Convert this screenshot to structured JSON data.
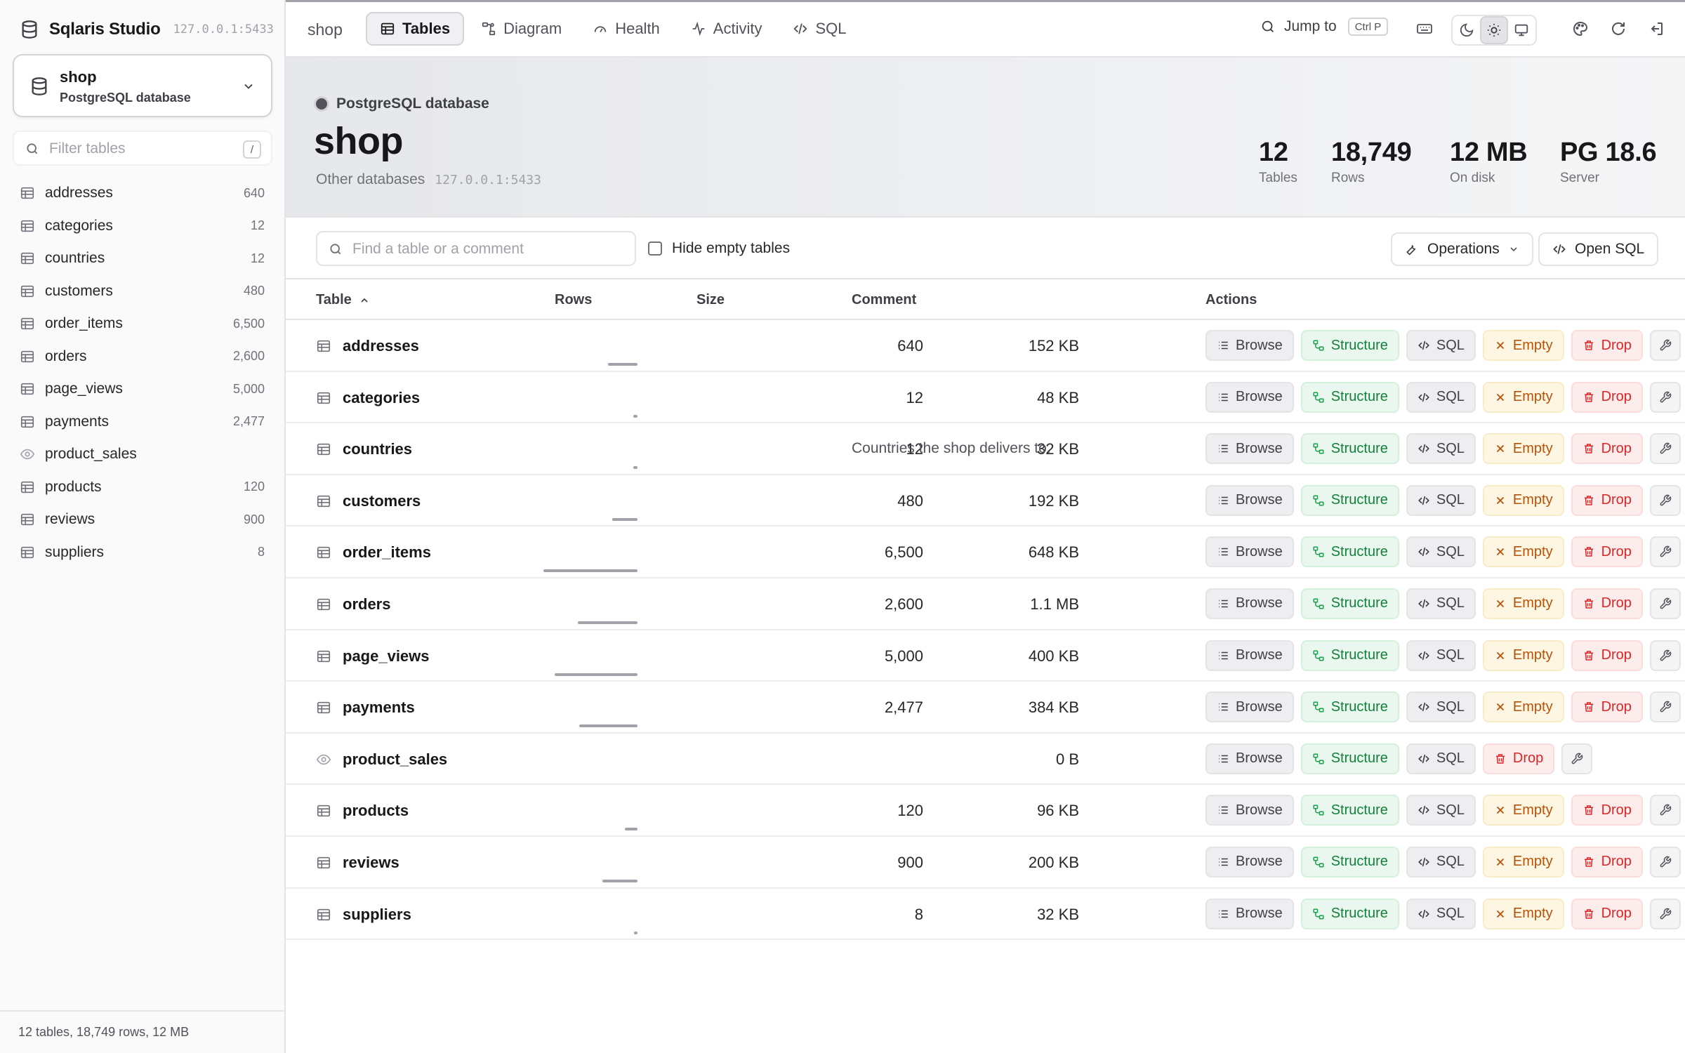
{
  "app": {
    "name": "Sqlaris Studio",
    "host": "127.0.0.1:5433"
  },
  "db_picker": {
    "name": "shop",
    "kind": "PostgreSQL database"
  },
  "sidebar": {
    "filter_placeholder": "Filter tables",
    "filter_shortcut": "/",
    "items": [
      {
        "name": "addresses",
        "count": "640",
        "kind": "table"
      },
      {
        "name": "categories",
        "count": "12",
        "kind": "table"
      },
      {
        "name": "countries",
        "count": "12",
        "kind": "table"
      },
      {
        "name": "customers",
        "count": "480",
        "kind": "table"
      },
      {
        "name": "order_items",
        "count": "6,500",
        "kind": "table"
      },
      {
        "name": "orders",
        "count": "2,600",
        "kind": "table"
      },
      {
        "name": "page_views",
        "count": "5,000",
        "kind": "table"
      },
      {
        "name": "payments",
        "count": "2,477",
        "kind": "table"
      },
      {
        "name": "product_sales",
        "count": "",
        "kind": "view"
      },
      {
        "name": "products",
        "count": "120",
        "kind": "table"
      },
      {
        "name": "reviews",
        "count": "900",
        "kind": "table"
      },
      {
        "name": "suppliers",
        "count": "8",
        "kind": "table"
      }
    ],
    "footer": "12 tables, 18,749 rows, 12 MB"
  },
  "topbar": {
    "breadcrumb": "shop",
    "tabs": [
      {
        "label": "Tables",
        "icon": "table-icon",
        "active": true
      },
      {
        "label": "Diagram",
        "icon": "diagram-icon",
        "active": false
      },
      {
        "label": "Health",
        "icon": "gauge-icon",
        "active": false
      },
      {
        "label": "Activity",
        "icon": "activity-icon",
        "active": false
      },
      {
        "label": "SQL",
        "icon": "code-icon",
        "active": false
      }
    ],
    "jump_label": "Jump to",
    "jump_shortcut": "Ctrl P"
  },
  "header": {
    "kind": "PostgreSQL database",
    "title": "shop",
    "other_link": "Other databases",
    "host": "127.0.0.1:5433",
    "stats": [
      {
        "value": "12",
        "label": "Tables"
      },
      {
        "value": "18,749",
        "label": "Rows"
      },
      {
        "value": "12 MB",
        "label": "On disk"
      },
      {
        "value": "PG 18.6",
        "label": "Server"
      }
    ]
  },
  "toolbar": {
    "find_placeholder": "Find a table or a comment",
    "hide_empty_label": "Hide empty tables",
    "operations_label": "Operations",
    "open_sql_label": "Open SQL"
  },
  "table": {
    "columns": {
      "table": "Table",
      "rows": "Rows",
      "size": "Size",
      "comment": "Comment",
      "actions": "Actions"
    },
    "action_labels": {
      "browse": "Browse",
      "structure": "Structure",
      "sql": "SQL",
      "empty": "Empty",
      "drop": "Drop"
    },
    "max_rows": 6500,
    "rows": [
      {
        "name": "addresses",
        "rows": "640",
        "row_count": 640,
        "size": "152 KB",
        "comment": "",
        "kind": "table"
      },
      {
        "name": "categories",
        "rows": "12",
        "row_count": 12,
        "size": "48 KB",
        "comment": "",
        "kind": "table"
      },
      {
        "name": "countries",
        "rows": "12",
        "row_count": 12,
        "size": "32 KB",
        "comment": "Countries the shop delivers to.",
        "kind": "table"
      },
      {
        "name": "customers",
        "rows": "480",
        "row_count": 480,
        "size": "192 KB",
        "comment": "",
        "kind": "table"
      },
      {
        "name": "order_items",
        "rows": "6,500",
        "row_count": 6500,
        "size": "648 KB",
        "comment": "",
        "kind": "table"
      },
      {
        "name": "orders",
        "rows": "2,600",
        "row_count": 2600,
        "size": "1.1 MB",
        "comment": "",
        "kind": "table"
      },
      {
        "name": "page_views",
        "rows": "5,000",
        "row_count": 5000,
        "size": "400 KB",
        "comment": "",
        "kind": "table"
      },
      {
        "name": "payments",
        "rows": "2,477",
        "row_count": 2477,
        "size": "384 KB",
        "comment": "",
        "kind": "table"
      },
      {
        "name": "product_sales",
        "rows": "",
        "row_count": 0,
        "size": "0 B",
        "comment": "",
        "kind": "view"
      },
      {
        "name": "products",
        "rows": "120",
        "row_count": 120,
        "size": "96 KB",
        "comment": "",
        "kind": "table"
      },
      {
        "name": "reviews",
        "rows": "900",
        "row_count": 900,
        "size": "200 KB",
        "comment": "",
        "kind": "table"
      },
      {
        "name": "suppliers",
        "rows": "8",
        "row_count": 8,
        "size": "32 KB",
        "comment": "",
        "kind": "table"
      }
    ]
  }
}
